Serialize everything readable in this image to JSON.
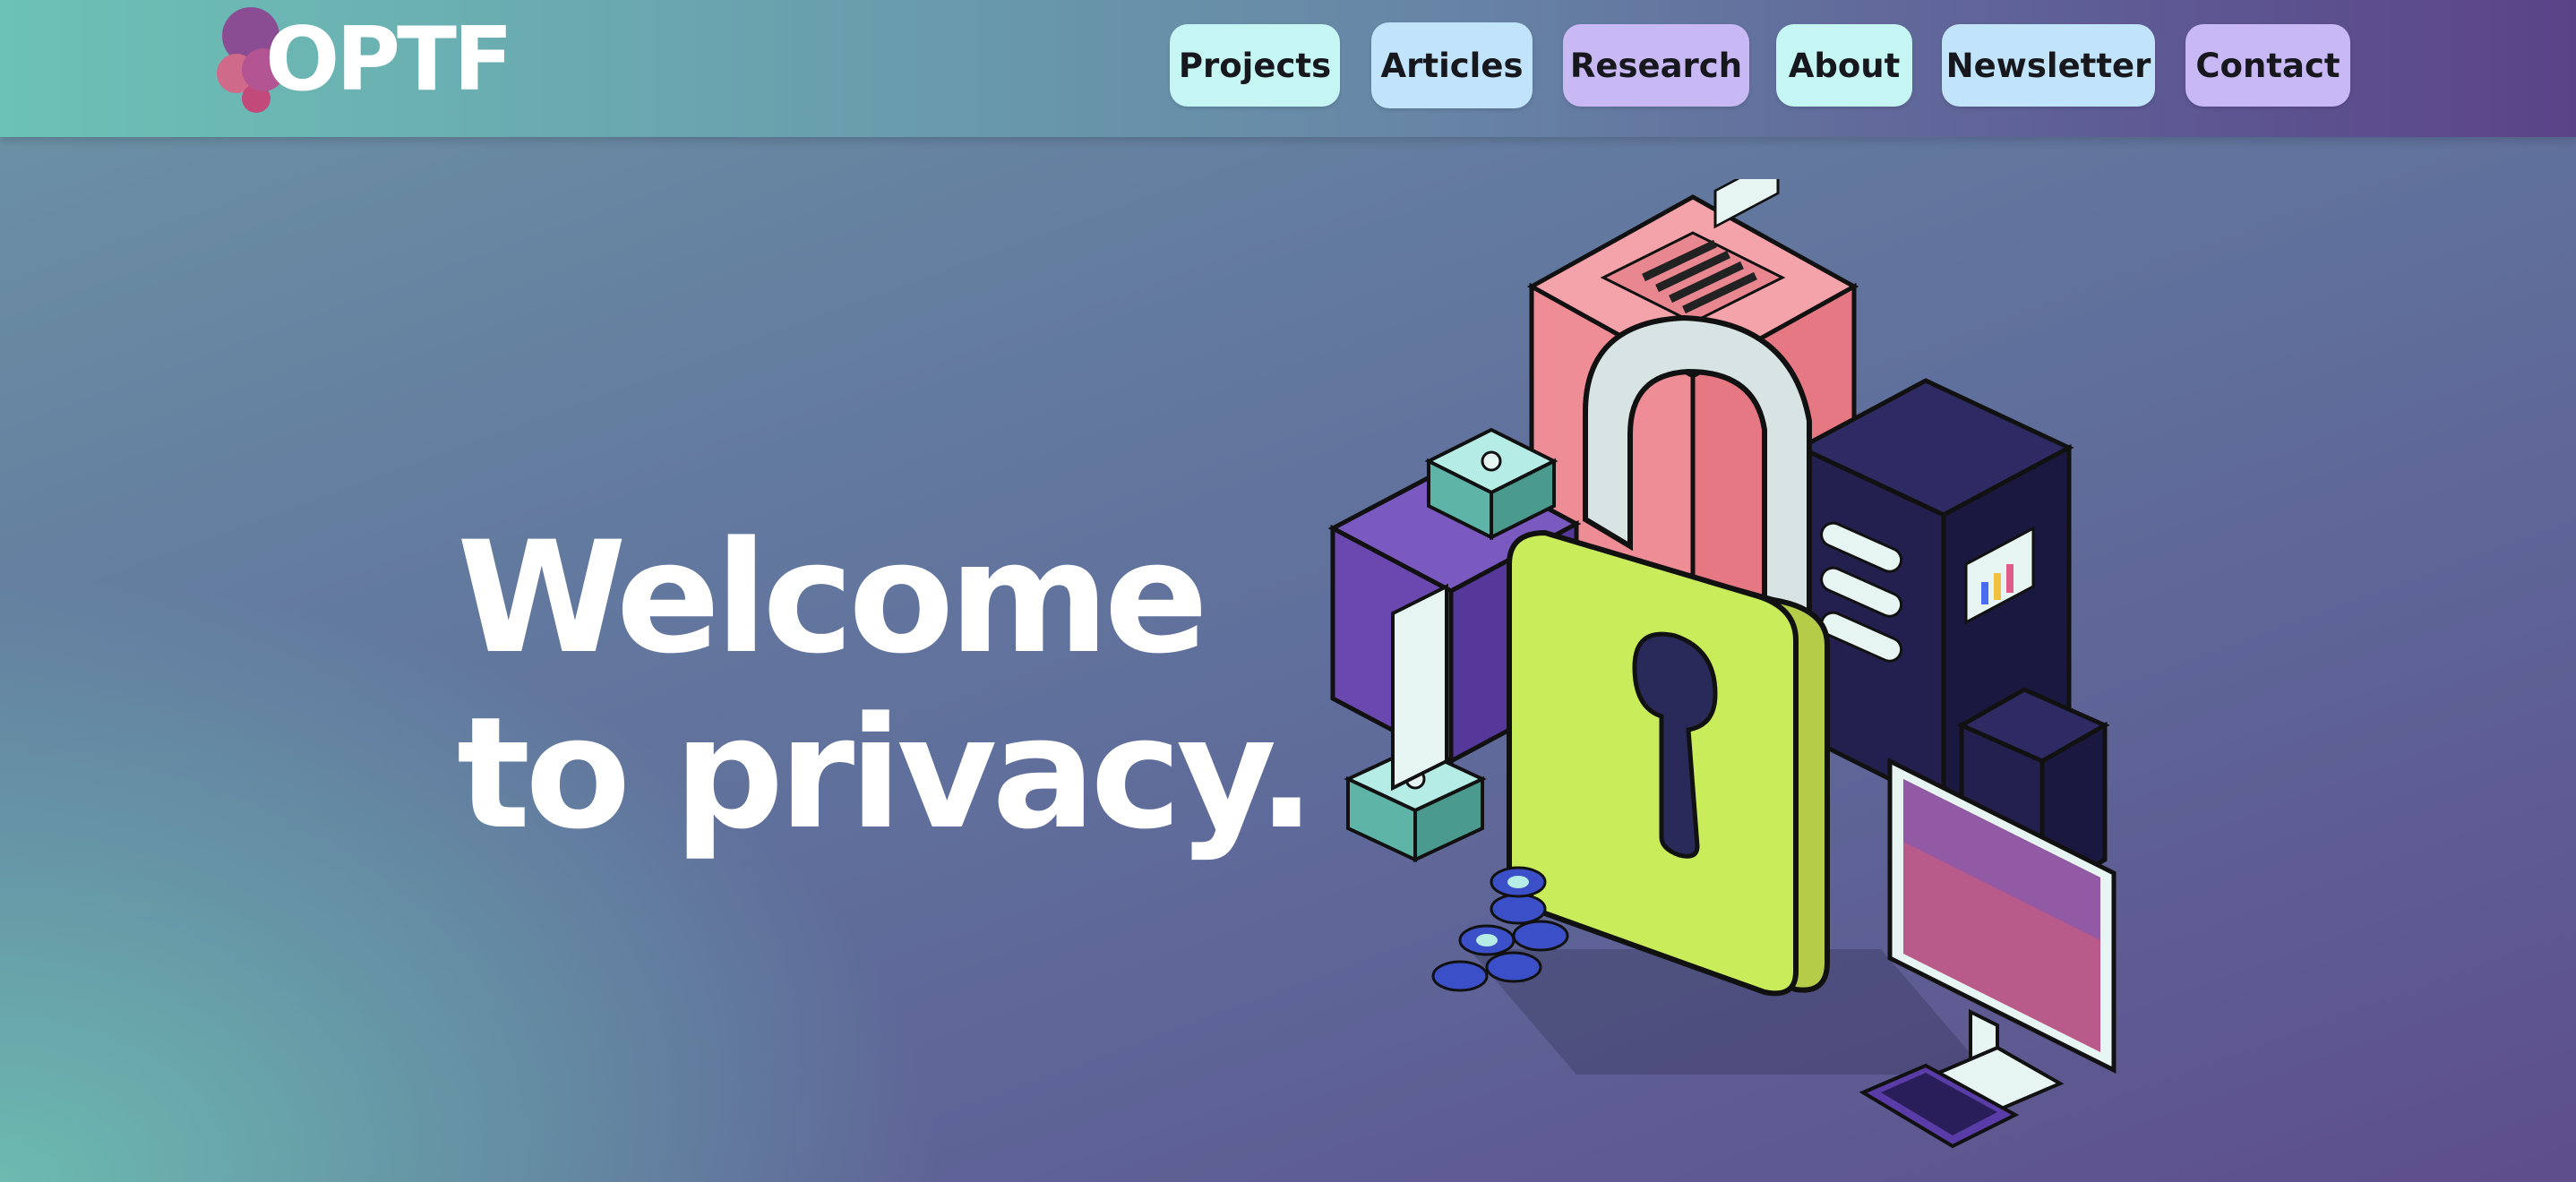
{
  "header": {
    "logo_text": "OPTF",
    "nav": [
      {
        "label": "Projects",
        "color": "#c6f6f4"
      },
      {
        "label": "Articles",
        "color": "#c2e4fa"
      },
      {
        "label": "Research",
        "color": "#c8b8f4"
      },
      {
        "label": "About",
        "color": "#c6f6f4"
      },
      {
        "label": "Newsletter",
        "color": "#c2e4fa"
      },
      {
        "label": "Contact",
        "color": "#c8b8f4"
      }
    ]
  },
  "hero": {
    "title_line1": "Welcome",
    "title_line2": "to privacy."
  },
  "colors": {
    "header_left": "#6cc2b6",
    "header_right": "#5b4388",
    "lock_body": "#c8ec5a",
    "server_pink": "#f0868e",
    "server_dark": "#25224f",
    "device_teal": "#5eb4a6",
    "coin_blue": "#3a4fc8"
  },
  "icons": [
    "logo-mark",
    "padlock-icon",
    "server-icon",
    "monitor-icon",
    "keyboard-icon",
    "coins-icon"
  ]
}
